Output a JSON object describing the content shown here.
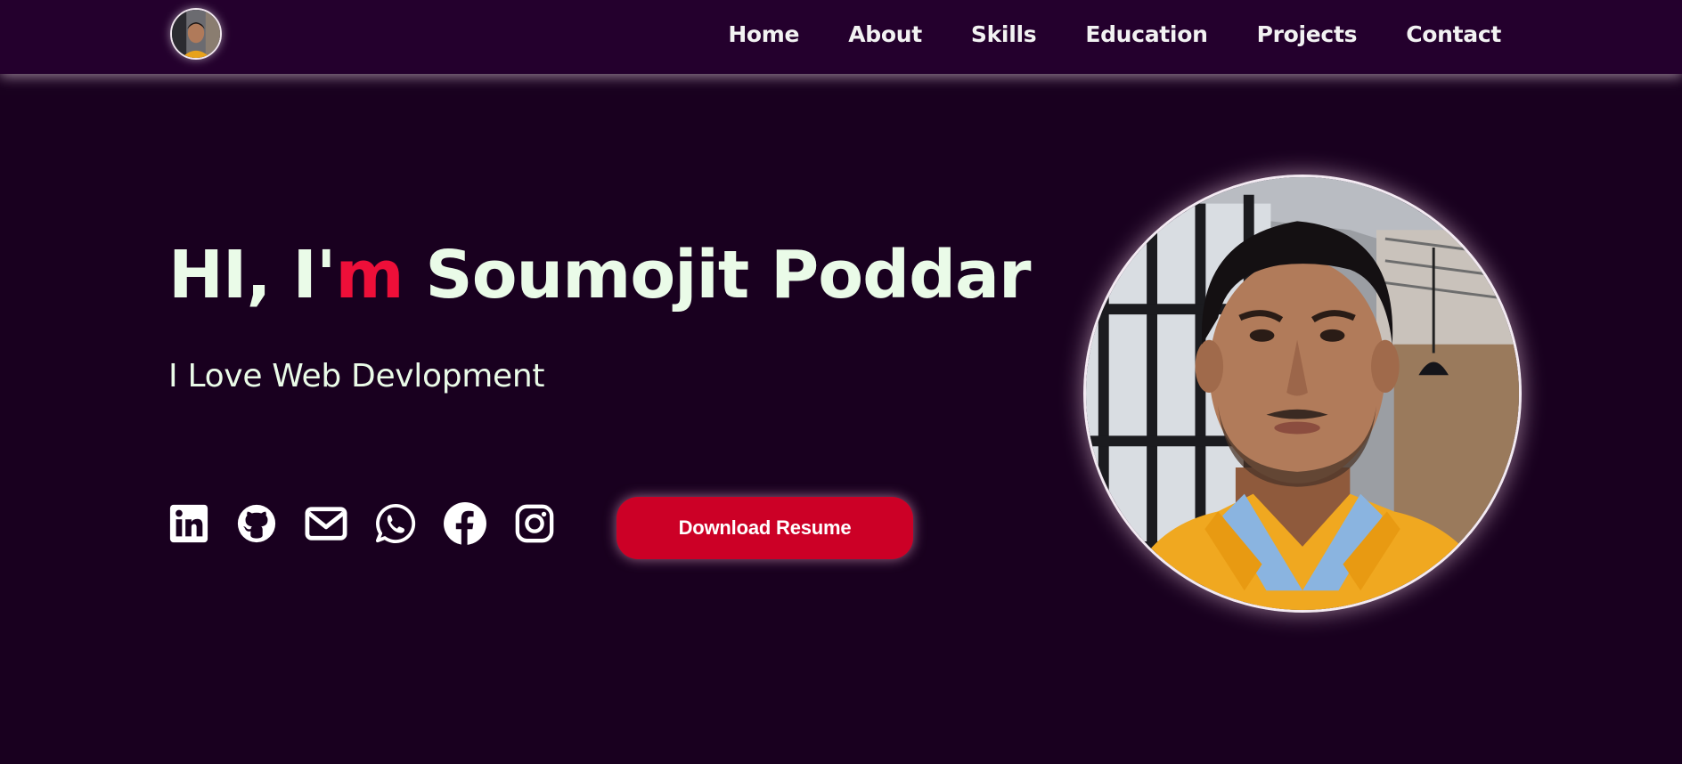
{
  "nav": {
    "avatar_alt": "Soumojit Poddar",
    "links": [
      {
        "label": "Home"
      },
      {
        "label": "About"
      },
      {
        "label": "Skills"
      },
      {
        "label": "Education"
      },
      {
        "label": "Projects"
      },
      {
        "label": "Contact"
      }
    ]
  },
  "hero": {
    "title_prefix": "HI, I'",
    "title_accent": "m",
    "title_suffix": " Soumojit Poddar",
    "subtitle": "I Love Web Devlopment",
    "download_label": "Download Resume",
    "social_icons": [
      "linkedin-icon",
      "github-icon",
      "email-icon",
      "whatsapp-icon",
      "facebook-icon",
      "instagram-icon"
    ]
  },
  "colors": {
    "background": "#19001f",
    "navbar": "#24002d",
    "text": "#eafbe8",
    "accent": "#ee0f39",
    "button": "#cc0026"
  }
}
